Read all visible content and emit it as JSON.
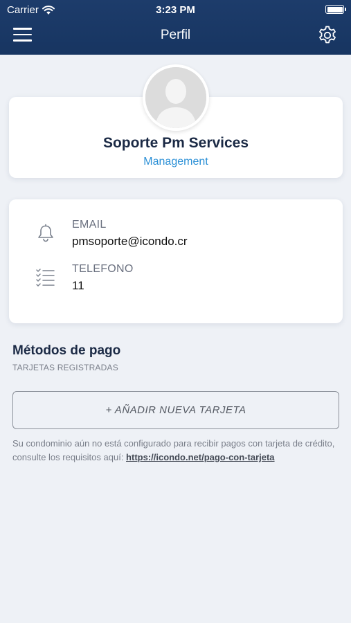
{
  "status_bar": {
    "carrier": "Carrier",
    "time": "3:23 PM"
  },
  "nav": {
    "title": "Perfil",
    "menu_icon": "hamburger-menu-icon",
    "settings_icon": "gear-icon"
  },
  "profile": {
    "avatar_icon": "user-placeholder-icon",
    "name": "Soporte Pm Services",
    "role": "Management"
  },
  "contact": {
    "email": {
      "icon": "bell-icon",
      "label": "EMAIL",
      "value": "pmsoporte@icondo.cr"
    },
    "phone": {
      "icon": "checklist-icon",
      "label": "TELEFONO",
      "value": "11"
    }
  },
  "payment": {
    "title": "Métodos de pago",
    "subtitle": "TARJETAS REGISTRADAS",
    "add_button": "+ AÑADIR NUEVA TARJETA",
    "notice_text": "Su condominio aún no está configurado para recibir pagos con tarjeta de crédito, consulte los requisitos aquí: ",
    "notice_link": "https://icondo.net/pago-con-tarjeta"
  },
  "colors": {
    "header": "#1d3c6b",
    "background": "#eef1f6",
    "accent": "#2a8fd6",
    "title": "#1b2a45"
  }
}
